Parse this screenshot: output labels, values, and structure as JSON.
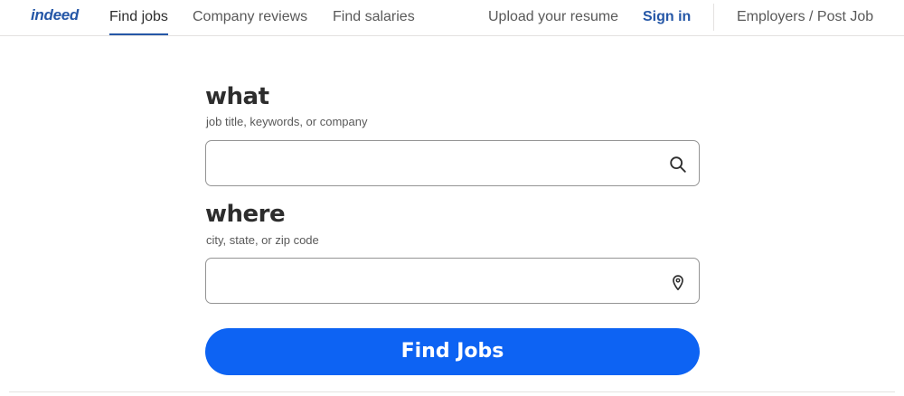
{
  "logo": {
    "text": "indeed"
  },
  "nav": {
    "find_jobs": "Find jobs",
    "company_reviews": "Company reviews",
    "find_salaries": "Find salaries",
    "upload_resume": "Upload your resume",
    "sign_in": "Sign in",
    "employers": "Employers / Post Job"
  },
  "search": {
    "what_label": "what",
    "what_hint": "job title, keywords, or company",
    "what_value": "",
    "what_icon": "search-icon",
    "where_label": "where",
    "where_hint": "city, state, or zip code",
    "where_value": "",
    "where_icon": "location-pin-icon",
    "submit_label": "Find Jobs"
  },
  "colors": {
    "brand_blue": "#2557a7",
    "button_blue": "#0d63f3",
    "text": "#2d2d2d",
    "muted": "#595959",
    "border": "#949494"
  }
}
